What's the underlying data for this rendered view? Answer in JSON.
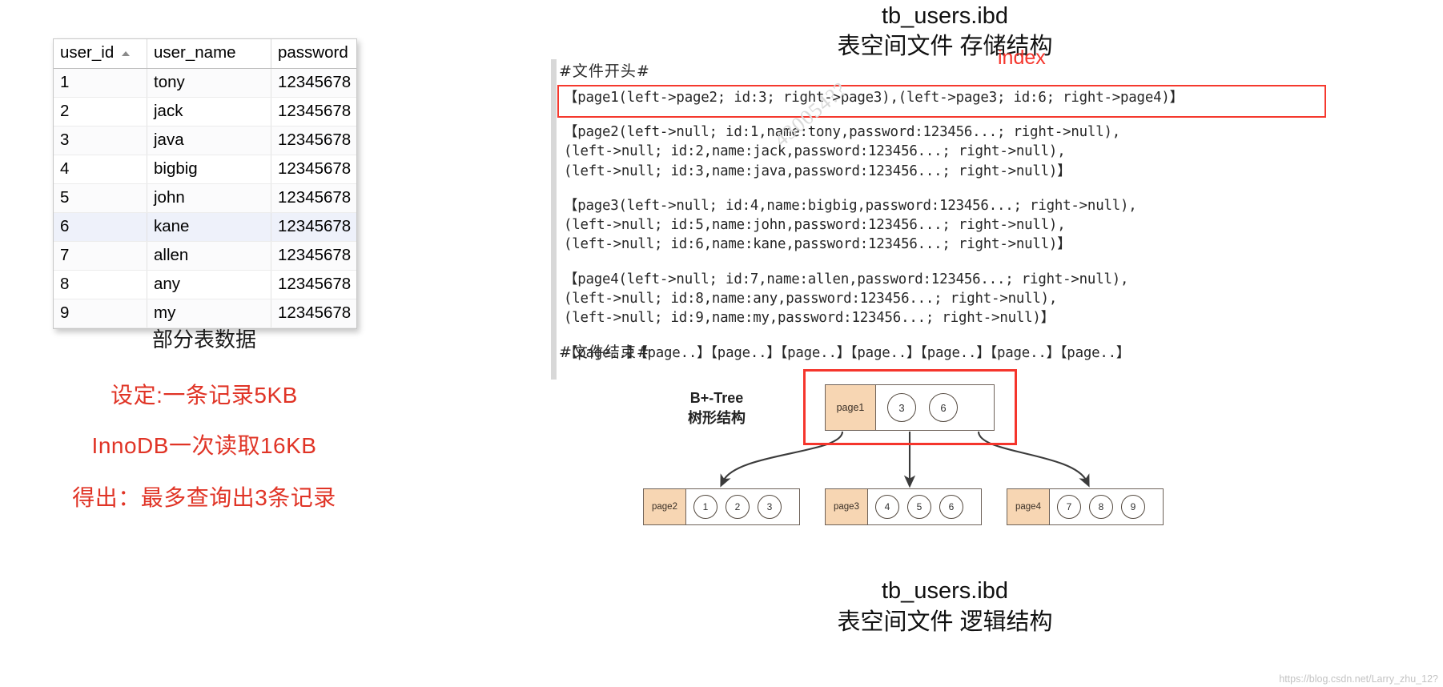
{
  "left": {
    "table": {
      "columns": [
        "user_id",
        "user_name",
        "password"
      ],
      "sort_column": "user_id",
      "sort_direction": "asc",
      "rows": [
        {
          "user_id": "1",
          "user_name": "tony",
          "password": "12345678"
        },
        {
          "user_id": "2",
          "user_name": "jack",
          "password": "12345678"
        },
        {
          "user_id": "3",
          "user_name": "java",
          "password": "12345678"
        },
        {
          "user_id": "4",
          "user_name": "bigbig",
          "password": "12345678"
        },
        {
          "user_id": "5",
          "user_name": "john",
          "password": "12345678"
        },
        {
          "user_id": "6",
          "user_name": "kane",
          "password": "12345678"
        },
        {
          "user_id": "7",
          "user_name": "allen",
          "password": "12345678"
        },
        {
          "user_id": "8",
          "user_name": "any",
          "password": "12345678"
        },
        {
          "user_id": "9",
          "user_name": "my",
          "password": "12345678"
        }
      ],
      "highlighted_row_index": 5
    },
    "caption": "部分表数据",
    "notes": [
      "设定:一条记录5KB",
      "InnoDB一次读取16KB",
      "得出：最多查询出3条记录"
    ],
    "note_color": "#e03426"
  },
  "right": {
    "title": "tb_users.ibd",
    "subtitle": "表空间文件 存储结构",
    "index_label": "index",
    "index_label_color": "#f5352c",
    "file_begin_marker": "#文件开头#",
    "file_end_marker": "#文件结束#",
    "watermark_number": "430054??",
    "index_page_line": "【page1(left->page2; id:3; right->page3),(left->page3; id:6; right->page4)】",
    "data_pages": [
      "【page2(left->null; id:1,name:tony,password:123456...; right->null),\n(left->null; id:2,name:jack,password:123456...; right->null),\n(left->null; id:3,name:java,password:123456...; right->null)】",
      "【page3(left->null; id:4,name:bigbig,password:123456...; right->null),\n(left->null; id:5,name:john,password:123456...; right->null),\n(left->null; id:6,name:kane,password:123456...; right->null)】",
      "【page4(left->null; id:7,name:allen,password:123456...; right->null),\n(left->null; id:8,name:any,password:123456...; right->null),\n(left->null; id:9,name:my,password:123456...; right->null)】",
      "【page..】【page..】【page..】【page..】【page..】【page..】【page..】【page..】"
    ]
  },
  "tree": {
    "label_line1": "B+-Tree",
    "label_line2": "树形结构",
    "root": {
      "page": "page1",
      "keys": [
        "3",
        "6"
      ]
    },
    "leaves": [
      {
        "page": "page2",
        "keys": [
          "1",
          "2",
          "3"
        ]
      },
      {
        "page": "page3",
        "keys": [
          "4",
          "5",
          "6"
        ]
      },
      {
        "page": "page4",
        "keys": [
          "7",
          "8",
          "9"
        ]
      }
    ],
    "bottom_title": "tb_users.ibd",
    "bottom_subtitle": "表空间文件 逻辑结构",
    "highlight_color": "#f5352c"
  },
  "watermark": "https://blog.csdn.net/Larry_zhu_12?"
}
